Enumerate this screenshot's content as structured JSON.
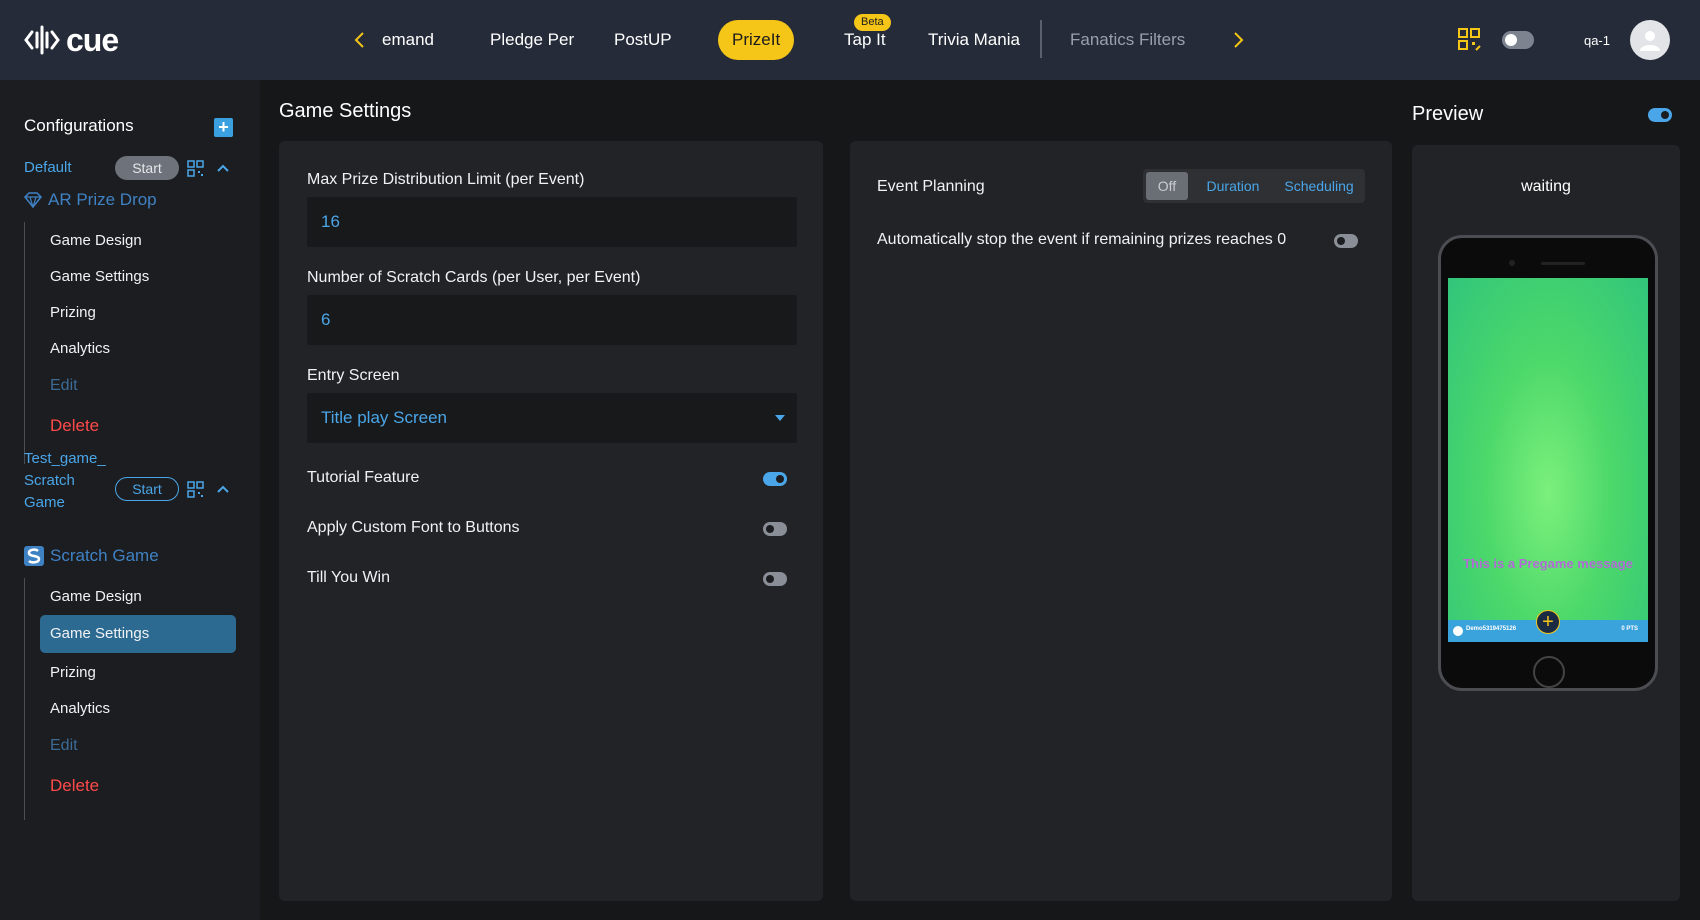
{
  "header": {
    "logo_text": "cue",
    "tabs": [
      "emand",
      "Pledge Per",
      "PostUP",
      "PrizeIt",
      "Tap It",
      "Trivia Mania",
      "Fanatics Filters"
    ],
    "active_tab": "PrizeIt",
    "beta_badge": "Beta",
    "user_label": "qa-1",
    "accent_color": "#f5c518"
  },
  "sidebar": {
    "title": "Configurations",
    "add_label": "+",
    "games": [
      {
        "name": "Default",
        "start_label": "Start",
        "type_label": "AR Prize Drop",
        "items": [
          "Game Design",
          "Game Settings",
          "Prizing",
          "Analytics",
          "Edit",
          "Delete"
        ]
      },
      {
        "name_lines": [
          "Test_game_",
          "Scratch",
          "Game"
        ],
        "start_label": "Start",
        "type_label": "Scratch Game",
        "items": [
          "Game Design",
          "Game Settings",
          "Prizing",
          "Analytics",
          "Edit",
          "Delete"
        ],
        "active_item": "Game Settings"
      }
    ]
  },
  "settings": {
    "title": "Game Settings",
    "max_prize_label": "Max Prize Distribution Limit (per Event)",
    "max_prize_value": "16",
    "scratch_cards_label": "Number of Scratch Cards (per User, per Event)",
    "scratch_cards_value": "6",
    "entry_screen_label": "Entry Screen",
    "entry_screen_value": "Title play Screen",
    "toggles": [
      {
        "label": "Tutorial Feature",
        "on": true
      },
      {
        "label": "Apply Custom Font to Buttons",
        "on": false
      },
      {
        "label": "Till You Win",
        "on": false
      }
    ]
  },
  "event_planning": {
    "label": "Event Planning",
    "options": [
      "Off",
      "Duration",
      "Scheduling"
    ],
    "selected": "Off",
    "auto_stop_label": "Automatically stop the event if remaining prizes reaches 0",
    "auto_stop_on": false
  },
  "preview": {
    "title": "Preview",
    "toggle_on": true,
    "status": "waiting",
    "pregame_message": "This is a Pregame message",
    "user_id": "Demo5319475126",
    "points": "0 PTS"
  }
}
